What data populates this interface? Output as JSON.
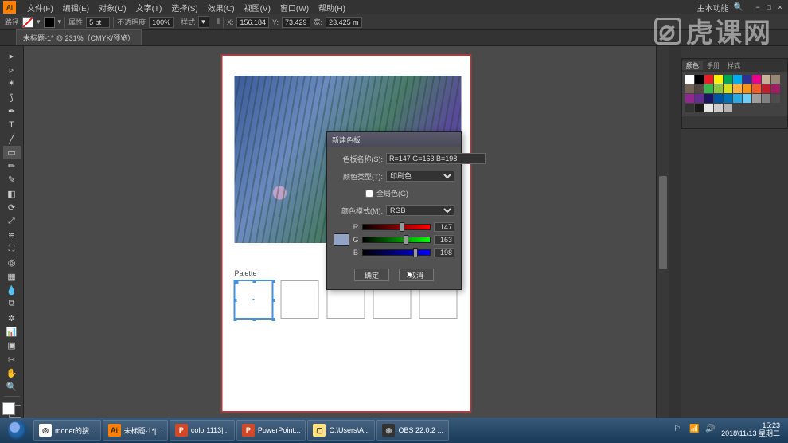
{
  "app": {
    "logo_text": "Ai",
    "search_label": "主本功能"
  },
  "menu": [
    "文件(F)",
    "编辑(E)",
    "对象(O)",
    "文字(T)",
    "选择(S)",
    "效果(C)",
    "视图(V)",
    "窗口(W)",
    "帮助(H)"
  ],
  "options": {
    "label_prefix": "路径",
    "stroke_label": "属性",
    "stroke_width": "5 pt",
    "opacity_label": "不透明度",
    "opacity": "100%",
    "style_label": "样式",
    "x_label": "X:",
    "x": "156.184",
    "y_label": "Y:",
    "y": "73.429",
    "w_label": "宽:",
    "w": "23.425 m"
  },
  "tab": {
    "label": "未标题-1* @ 231%（CMYK/预览）"
  },
  "document": {
    "palette_label": "Palette",
    "zoom": "231%"
  },
  "dialog": {
    "title": "新建色板",
    "name_label": "色板名称(S):",
    "name_value": "R=147 G=163 B=198",
    "type_label": "颜色类型(T):",
    "type_value": "印刷色",
    "global_label": "全局色(G)",
    "mode_label": "颜色模式(M):",
    "mode_value": "RGB",
    "r_label": "R",
    "r_val": "147",
    "g_label": "G",
    "g_val": "163",
    "b_label": "B",
    "b_val": "198",
    "ok": "确定",
    "cancel": "取消"
  },
  "swatches": {
    "tabs": [
      "颜色",
      "手册",
      "样式"
    ],
    "colors": [
      "#ffffff",
      "#000000",
      "#ed1c24",
      "#fff200",
      "#00a651",
      "#00aeef",
      "#2e3192",
      "#ec008c",
      "#c7b299",
      "#998675",
      "#736357",
      "#534741",
      "#39b54a",
      "#8dc63f",
      "#d7df23",
      "#fbb040",
      "#f7941e",
      "#f15a29",
      "#be1e2d",
      "#9e1f63",
      "#92278f",
      "#662d91",
      "#1b1464",
      "#0054a6",
      "#0072bc",
      "#29abe2",
      "#6dcff6",
      "#9e9e9e",
      "#808080",
      "#4d4d4d",
      "#333333",
      "#1a1a1a",
      "#e6e6e6",
      "#cccccc",
      "#b3b3b3"
    ]
  },
  "taskbar": {
    "items": [
      {
        "icon_bg": "#fff",
        "icon_fg": "#333",
        "icon": "◎",
        "label": "monet的搜..."
      },
      {
        "icon_bg": "#ff7f00",
        "icon_fg": "#330",
        "icon": "Ai",
        "label": "未标题-1*|..."
      },
      {
        "icon_bg": "#d24726",
        "icon_fg": "#fff",
        "icon": "P",
        "label": "color1113|..."
      },
      {
        "icon_bg": "#d24726",
        "icon_fg": "#fff",
        "icon": "P",
        "label": "PowerPoint..."
      },
      {
        "icon_bg": "#ffe27a",
        "icon_fg": "#333",
        "icon": "▢",
        "label": "C:\\Users\\A..."
      },
      {
        "icon_bg": "#333",
        "icon_fg": "#aaa",
        "icon": "◉",
        "label": "OBS 22.0.2 ..."
      }
    ],
    "clock_time": "15:23",
    "clock_date": "2018\\11\\13 星期二"
  },
  "watermark": "虎课网"
}
